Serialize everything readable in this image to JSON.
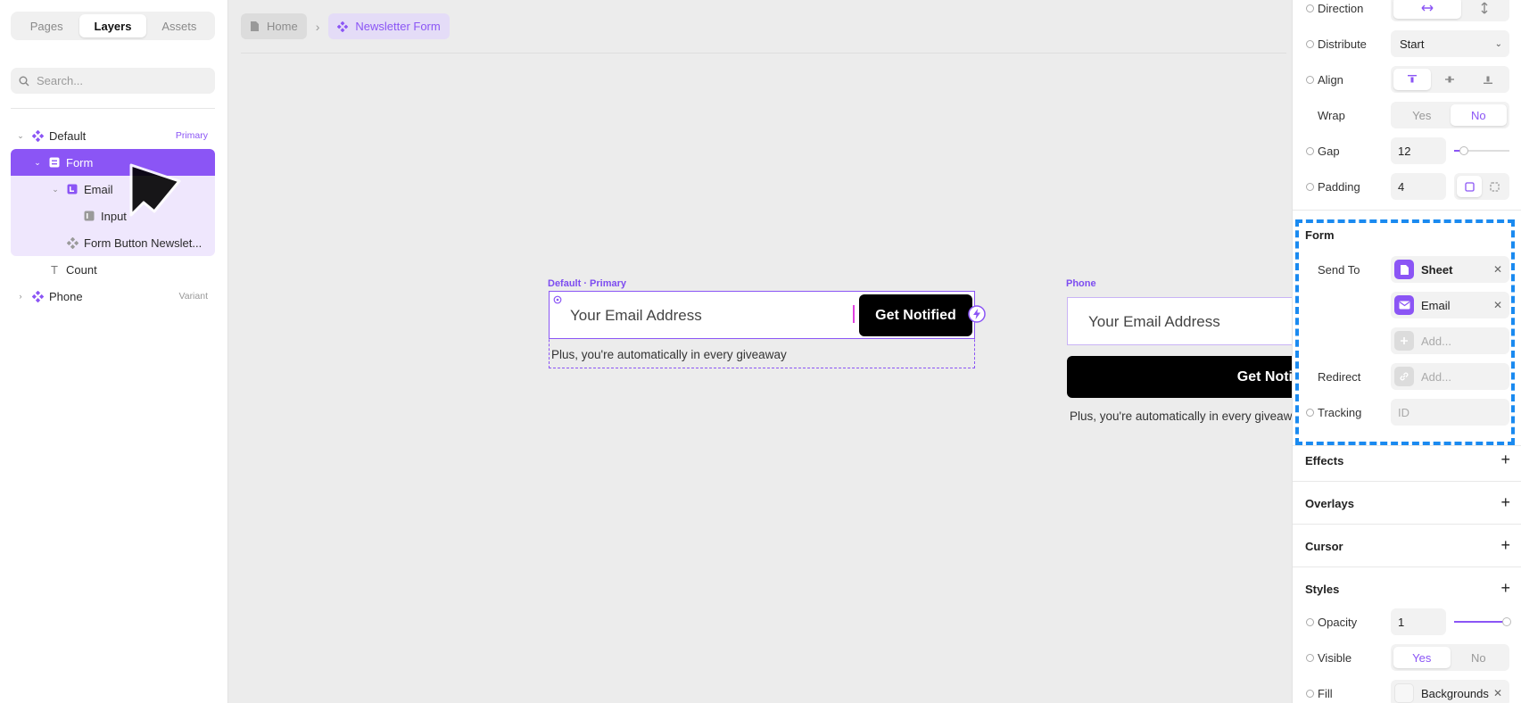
{
  "left_panel": {
    "tabs": [
      "Pages",
      "Layers",
      "Assets"
    ],
    "active_tab": "Layers",
    "search_placeholder": "Search...",
    "layers": [
      {
        "label": "Default",
        "tag": "Primary",
        "icon": "component-icon"
      },
      {
        "label": "Form",
        "icon": "form-icon"
      },
      {
        "label": "Email",
        "icon": "input-group-icon"
      },
      {
        "label": "Input",
        "icon": "input-icon"
      },
      {
        "label": "Form Button Newslet...",
        "icon": "component-instance-icon"
      },
      {
        "label": "Count",
        "icon": "text-icon"
      },
      {
        "label": "Phone",
        "tag": "Variant",
        "icon": "component-icon"
      }
    ]
  },
  "canvas": {
    "breadcrumb": {
      "home": "Home",
      "current": "Newsletter Form"
    },
    "primary_frame": {
      "label": "Default · Primary",
      "input_placeholder": "Your Email Address",
      "button": "Get Notified",
      "caption": "Plus, you're automatically in every giveaway"
    },
    "phone_frame": {
      "label": "Phone",
      "input_placeholder": "Your Email Address",
      "button": "Get Noti",
      "caption": "Plus, you're automatically in every giveaw"
    }
  },
  "right_panel": {
    "direction_label": "Direction",
    "distribute_label": "Distribute",
    "distribute_value": "Start",
    "align_label": "Align",
    "wrap_label": "Wrap",
    "wrap_yes": "Yes",
    "wrap_no": "No",
    "gap_label": "Gap",
    "gap_value": "12",
    "padding_label": "Padding",
    "padding_value": "4",
    "form_section": "Form",
    "send_to_label": "Send To",
    "send_to_items": [
      "Sheet",
      "Email"
    ],
    "add_placeholder": "Add...",
    "redirect_label": "Redirect",
    "redirect_placeholder": "Add...",
    "tracking_label": "Tracking",
    "tracking_placeholder": "ID",
    "effects": "Effects",
    "overlays": "Overlays",
    "cursor": "Cursor",
    "styles": "Styles",
    "opacity_label": "Opacity",
    "opacity_value": "1",
    "visible_label": "Visible",
    "visible_yes": "Yes",
    "visible_no": "No",
    "fill_label": "Fill",
    "fill_value": "Backgrounds"
  },
  "colors": {
    "accent": "#8b55f5",
    "highlight": "#1a8af0"
  }
}
